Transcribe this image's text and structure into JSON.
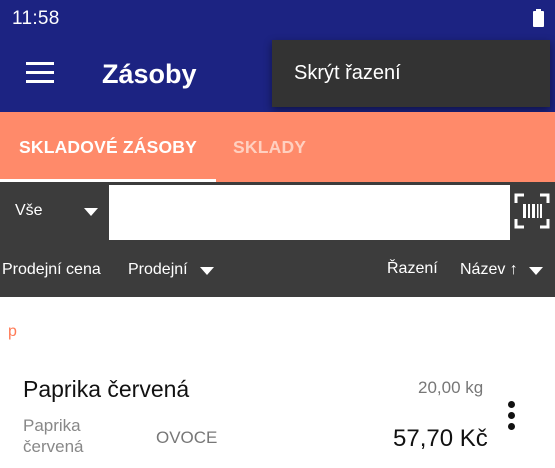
{
  "status_bar": {
    "time": "11:58",
    "battery_icon": "battery-full-icon"
  },
  "app_bar": {
    "title": "Zásoby",
    "menu_icon": "hamburger-menu-icon"
  },
  "popup_menu": {
    "item": "Skrýt řazení"
  },
  "tabs": [
    {
      "label": "SKLADOVÉ ZÁSOBY",
      "active": true
    },
    {
      "label": "SKLADY",
      "active": false
    }
  ],
  "filter": {
    "selected": "Vše",
    "search_value": "",
    "scan_icon": "barcode-scan-icon"
  },
  "sort": {
    "price_label": "Prodejní cena",
    "price_value": "Prodejní",
    "order_label": "Řazení",
    "order_value": "Název ↑"
  },
  "section_header": "p",
  "items": [
    {
      "name": "Paprika červená",
      "quantity": "20,00 kg",
      "description": "Paprika červená",
      "category": "OVOCE",
      "price": "57,70 Kč"
    }
  ],
  "colors": {
    "primary": "#1c2382",
    "accent": "#ff8a6a",
    "bar_dark": "#3c3c3c",
    "popup": "#333333"
  }
}
